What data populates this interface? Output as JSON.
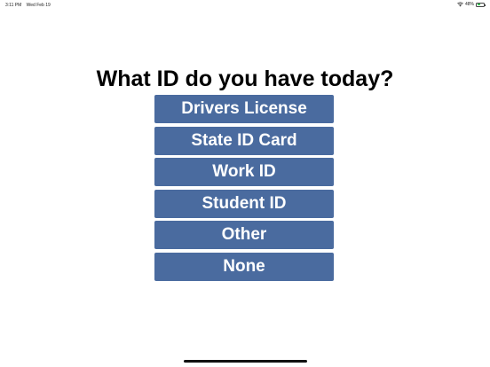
{
  "status_bar": {
    "time": "3:11 PM",
    "date": "Wed Feb 19",
    "battery_percent": "48%",
    "battery_level": 0.48,
    "battery_color": "#39c354"
  },
  "screen": {
    "title": "What ID do you have today?"
  },
  "options": [
    {
      "label": "Drivers License"
    },
    {
      "label": "State ID Card"
    },
    {
      "label": "Work ID"
    },
    {
      "label": "Student ID"
    },
    {
      "label": "Other"
    },
    {
      "label": "None"
    }
  ],
  "theme": {
    "button_color": "#4a6b9f",
    "button_text_color": "#ffffff"
  }
}
